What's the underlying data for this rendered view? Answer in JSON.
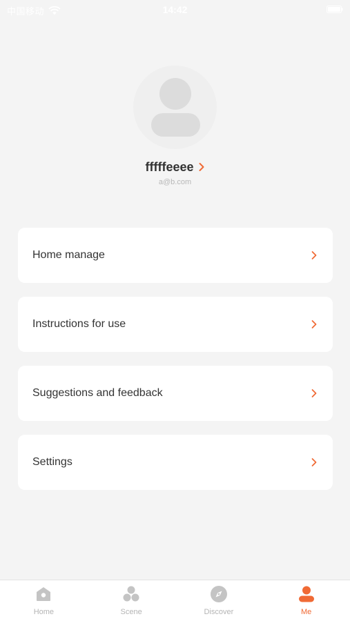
{
  "status_bar": {
    "carrier": "中国移动",
    "time": "14:42"
  },
  "profile": {
    "username": "fffffeeee",
    "email": "a@b.com",
    "avatar_icon": "user-avatar-icon"
  },
  "menu": [
    {
      "id": "home-manage",
      "label": "Home manage"
    },
    {
      "id": "instructions-for-use",
      "label": "Instructions for use"
    },
    {
      "id": "suggestions-and-feedback",
      "label": "Suggestions and feedback"
    },
    {
      "id": "settings",
      "label": "Settings"
    }
  ],
  "tabs": [
    {
      "id": "home",
      "label": "Home",
      "icon": "home-icon",
      "active": false
    },
    {
      "id": "scene",
      "label": "Scene",
      "icon": "scene-icon",
      "active": false
    },
    {
      "id": "discover",
      "label": "Discover",
      "icon": "compass-icon",
      "active": false
    },
    {
      "id": "me",
      "label": "Me",
      "icon": "person-icon",
      "active": true
    }
  ],
  "colors": {
    "accent": "#f06a35",
    "background": "#f4f4f4",
    "card": "#ffffff",
    "text": "#333333",
    "muted_text": "#b8b8b8",
    "inactive_icon": "#c4c4c4"
  }
}
